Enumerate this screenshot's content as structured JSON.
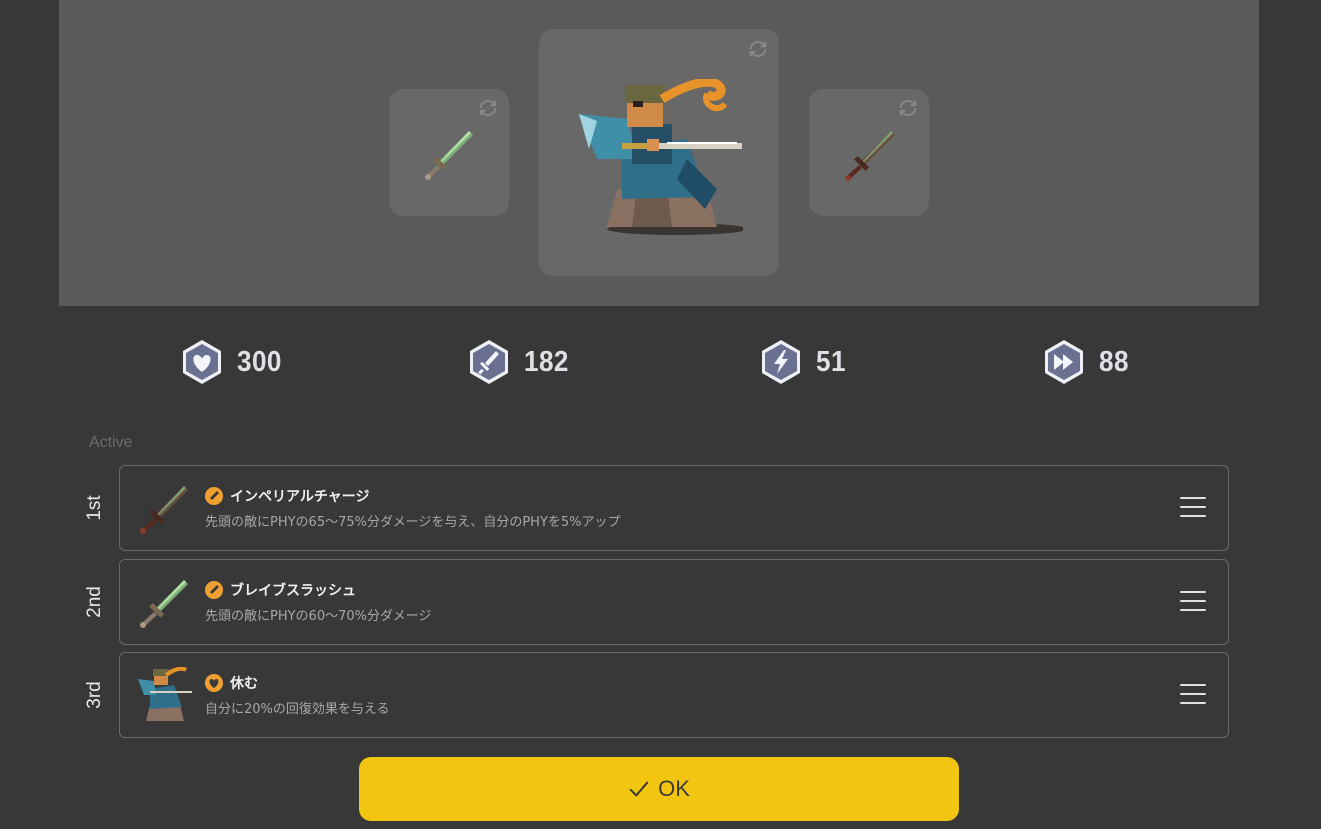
{
  "hero": {
    "stats": [
      {
        "icon": "heart-icon",
        "value": "300"
      },
      {
        "icon": "sword-icon",
        "value": "182"
      },
      {
        "icon": "lightning-icon",
        "value": "51"
      },
      {
        "icon": "fast-forward-icon",
        "value": "88"
      }
    ]
  },
  "skills": {
    "section_label": "Active",
    "items": [
      {
        "rank": "1st",
        "name": "インペリアルチャージ",
        "desc": "先頭の敵にPHYの65〜75%分ダメージを与え、自分のPHYを5%アップ",
        "type_icon": "sword-type-icon",
        "thumb": "dark-sword-icon"
      },
      {
        "rank": "2nd",
        "name": "ブレイブスラッシュ",
        "desc": "先頭の敵にPHYの60〜70%分ダメージ",
        "type_icon": "sword-type-icon",
        "thumb": "green-sword-icon"
      },
      {
        "rank": "3rd",
        "name": "休む",
        "desc": "自分に20%の回復効果を与える",
        "type_icon": "heart-type-icon",
        "thumb": "hero-portrait-icon"
      }
    ]
  },
  "actions": {
    "ok_label": "OK"
  },
  "colors": {
    "accent": "#f2c511",
    "type_badge": "#f0a030",
    "panel": "#5a5a5a",
    "background": "#383838"
  }
}
